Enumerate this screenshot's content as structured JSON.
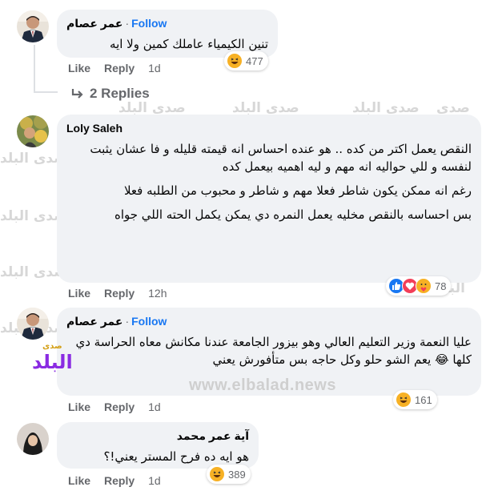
{
  "watermarks": [
    "صدى البلد",
    "صدى البلد",
    "صدى البلد",
    "صدى البلد",
    "صدى البلد",
    "صدى البلد",
    "صدى البلد",
    "صدى البلد",
    "صدى البلد",
    "صدى البلد",
    "صدى البلد",
    "صدى البلد",
    "صدى البلد",
    "صدى البلد",
    "صدى البلد",
    "صدى البلد"
  ],
  "site_watermark": "www.elbalad.news",
  "logo_text": "البلد",
  "logo_small": "صدى",
  "comments": [
    {
      "author": "عمر عصام",
      "separator": "·",
      "follow": "Follow",
      "paragraphs": [
        "تنين الكيمياء عاملك كمين ولا ايه"
      ],
      "reaction_count": "477",
      "reactions": [
        "haha-icon"
      ],
      "like": "Like",
      "reply": "Reply",
      "time": "1d"
    },
    {
      "author": "Loly Saleh",
      "paragraphs": [
        "النقص يعمل اكتر من كده .. هو عنده احساس انه قيمته قليله و فا عشان يثبت لنفسه و للي حواليه انه مهم و ليه اهميه بيعمل كده",
        "رغم انه ممكن يكون شاطر فعلا مهم و شاطر و محبوب من الطلبه فعلا",
        "بس احساسه بالنقص مخليه يعمل النمره دي يمكن يكمل الحته اللي جواه"
      ],
      "reaction_count": "78",
      "reactions": [
        "like-icon",
        "love-icon",
        "care-icon"
      ],
      "like": "Like",
      "reply": "Reply",
      "time": "12h"
    },
    {
      "author": "عمر عصام",
      "separator": "·",
      "follow": "Follow",
      "paragraphs": [
        "عليا النعمة وزير التعليم العالي وهو بيزور الجامعة عندنا مكانش معاه الحراسة دي كلها 😂 يعم الشو حلو وكل حاجه بس متأفورش يعني"
      ],
      "reaction_count": "161",
      "reactions": [
        "haha-icon"
      ],
      "like": "Like",
      "reply": "Reply",
      "time": "1d"
    },
    {
      "author": "آية عمر محمد",
      "paragraphs": [
        "هو ايه ده فرح المستر يعني!؟"
      ],
      "reaction_count": "389",
      "reactions": [
        "haha-icon"
      ],
      "like": "Like",
      "reply": "Reply",
      "time": "1d"
    }
  ],
  "replies_link": "2 Replies",
  "colors": {
    "bubble": "#f0f2f5",
    "link_blue": "#1877f2",
    "secondary_text": "#65676b",
    "like_blue": "#1877f2",
    "love_red": "#f33e58",
    "haha_yellow": "#f7b125"
  }
}
